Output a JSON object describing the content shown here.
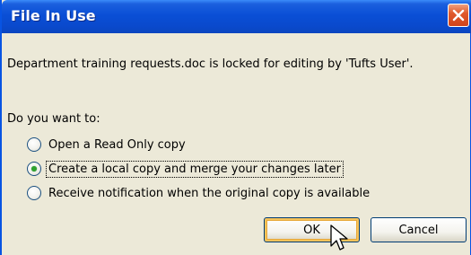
{
  "window": {
    "title": "File In Use",
    "close_label": "Close"
  },
  "message": "Department training requests.doc is locked for editing by 'Tufts User'.",
  "prompt": "Do you want to:",
  "options": [
    {
      "label": "Open a Read Only copy",
      "checked": false
    },
    {
      "label": "Create a local copy and merge your changes later",
      "checked": true
    },
    {
      "label": "Receive notification when the original copy is available",
      "checked": false
    }
  ],
  "buttons": {
    "ok": "OK",
    "cancel": "Cancel"
  },
  "colors": {
    "titlebar": "#0a4fd6",
    "background": "#ece9d8",
    "close_button": "#e05a2c",
    "radio_dot": "#30a230",
    "default_button_highlight": "#f6c35a"
  },
  "icons": {
    "close": "close-icon",
    "cursor": "mouse-pointer-icon"
  }
}
